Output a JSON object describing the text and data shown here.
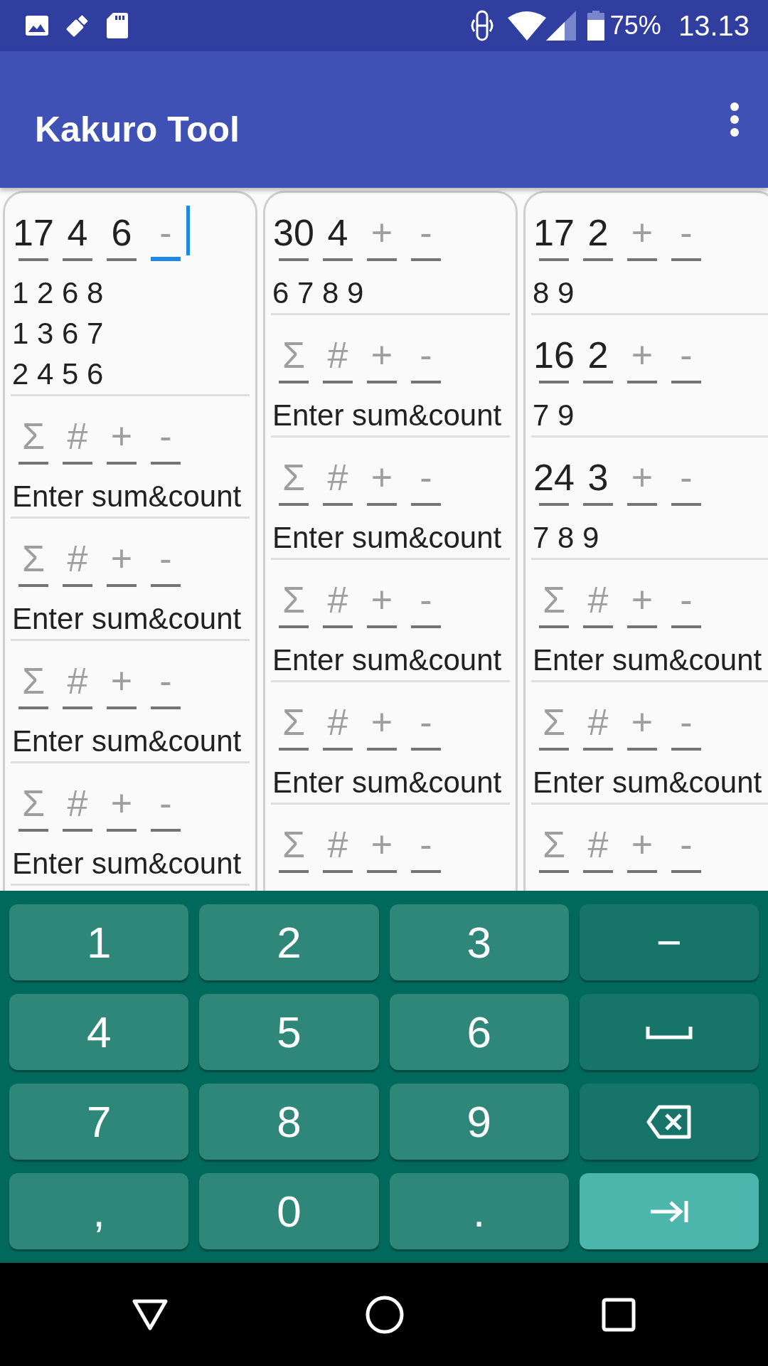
{
  "status_bar": {
    "battery": "75%",
    "time": "13.13"
  },
  "app_bar": {
    "title": "Kakuro Tool"
  },
  "columns": [
    {
      "entries": [
        {
          "fields": [
            {
              "value": "17",
              "focused": false
            },
            {
              "value": "4",
              "focused": false
            },
            {
              "value": "6",
              "focused": false
            },
            {
              "placeholder": "-",
              "focused": true
            }
          ],
          "lines": [
            "1 2 6 8",
            "1 3 6 7",
            "2 4 5 6"
          ]
        },
        {
          "fields": [
            {
              "placeholder": "Σ",
              "focused": false
            },
            {
              "placeholder": "#",
              "focused": false
            },
            {
              "placeholder": "+",
              "focused": false
            },
            {
              "placeholder": "-",
              "focused": false
            }
          ],
          "lines": [
            "Enter sum&count"
          ]
        },
        {
          "fields": [
            {
              "placeholder": "Σ",
              "focused": false
            },
            {
              "placeholder": "#",
              "focused": false
            },
            {
              "placeholder": "+",
              "focused": false
            },
            {
              "placeholder": "-",
              "focused": false
            }
          ],
          "lines": [
            "Enter sum&count"
          ]
        },
        {
          "fields": [
            {
              "placeholder": "Σ",
              "focused": false
            },
            {
              "placeholder": "#",
              "focused": false
            },
            {
              "placeholder": "+",
              "focused": false
            },
            {
              "placeholder": "-",
              "focused": false
            }
          ],
          "lines": [
            "Enter sum&count"
          ]
        },
        {
          "fields": [
            {
              "placeholder": "Σ",
              "focused": false
            },
            {
              "placeholder": "#",
              "focused": false
            },
            {
              "placeholder": "+",
              "focused": false
            },
            {
              "placeholder": "-",
              "focused": false
            }
          ],
          "lines": [
            "Enter sum&count"
          ]
        }
      ]
    },
    {
      "entries": [
        {
          "fields": [
            {
              "value": "30",
              "focused": false
            },
            {
              "value": "4",
              "focused": false
            },
            {
              "placeholder": "+",
              "focused": false
            },
            {
              "placeholder": "-",
              "focused": false
            }
          ],
          "lines": [
            "6 7 8 9"
          ]
        },
        {
          "fields": [
            {
              "placeholder": "Σ",
              "focused": false
            },
            {
              "placeholder": "#",
              "focused": false
            },
            {
              "placeholder": "+",
              "focused": false
            },
            {
              "placeholder": "-",
              "focused": false
            }
          ],
          "lines": [
            "Enter sum&count"
          ]
        },
        {
          "fields": [
            {
              "placeholder": "Σ",
              "focused": false
            },
            {
              "placeholder": "#",
              "focused": false
            },
            {
              "placeholder": "+",
              "focused": false
            },
            {
              "placeholder": "-",
              "focused": false
            }
          ],
          "lines": [
            "Enter sum&count"
          ]
        },
        {
          "fields": [
            {
              "placeholder": "Σ",
              "focused": false
            },
            {
              "placeholder": "#",
              "focused": false
            },
            {
              "placeholder": "+",
              "focused": false
            },
            {
              "placeholder": "-",
              "focused": false
            }
          ],
          "lines": [
            "Enter sum&count"
          ]
        },
        {
          "fields": [
            {
              "placeholder": "Σ",
              "focused": false
            },
            {
              "placeholder": "#",
              "focused": false
            },
            {
              "placeholder": "+",
              "focused": false
            },
            {
              "placeholder": "-",
              "focused": false
            }
          ],
          "lines": [
            "Enter sum&count"
          ]
        },
        {
          "fields": [
            {
              "placeholder": "Σ",
              "focused": false
            },
            {
              "placeholder": "#",
              "focused": false
            },
            {
              "placeholder": "+",
              "focused": false
            },
            {
              "placeholder": "-",
              "focused": false
            }
          ]
        }
      ]
    },
    {
      "entries": [
        {
          "fields": [
            {
              "value": "17",
              "focused": false
            },
            {
              "value": "2",
              "focused": false
            },
            {
              "placeholder": "+",
              "focused": false
            },
            {
              "placeholder": "-",
              "focused": false
            }
          ],
          "lines": [
            "8 9"
          ]
        },
        {
          "fields": [
            {
              "value": "16",
              "focused": false
            },
            {
              "value": "2",
              "focused": false
            },
            {
              "placeholder": "+",
              "focused": false
            },
            {
              "placeholder": "-",
              "focused": false
            }
          ],
          "lines": [
            "7 9"
          ]
        },
        {
          "fields": [
            {
              "value": "24",
              "focused": false
            },
            {
              "value": "3",
              "focused": false
            },
            {
              "placeholder": "+",
              "focused": false
            },
            {
              "placeholder": "-",
              "focused": false
            }
          ],
          "lines": [
            "7 8 9"
          ]
        },
        {
          "fields": [
            {
              "placeholder": "Σ",
              "focused": false
            },
            {
              "placeholder": "#",
              "focused": false
            },
            {
              "placeholder": "+",
              "focused": false
            },
            {
              "placeholder": "-",
              "focused": false
            }
          ],
          "lines": [
            "Enter sum&count"
          ]
        },
        {
          "fields": [
            {
              "placeholder": "Σ",
              "focused": false
            },
            {
              "placeholder": "#",
              "focused": false
            },
            {
              "placeholder": "+",
              "focused": false
            },
            {
              "placeholder": "-",
              "focused": false
            }
          ],
          "lines": [
            "Enter sum&count"
          ]
        },
        {
          "fields": [
            {
              "placeholder": "Σ",
              "focused": false
            },
            {
              "placeholder": "#",
              "focused": false
            },
            {
              "placeholder": "+",
              "focused": false
            },
            {
              "placeholder": "-",
              "focused": false
            }
          ]
        }
      ]
    }
  ],
  "keyboard": {
    "keys": [
      {
        "kind": "char",
        "label": "1"
      },
      {
        "kind": "char",
        "label": "2"
      },
      {
        "kind": "char",
        "label": "3"
      },
      {
        "kind": "func",
        "label": "−"
      },
      {
        "kind": "char",
        "label": "4"
      },
      {
        "kind": "char",
        "label": "5"
      },
      {
        "kind": "char",
        "label": "6"
      },
      {
        "kind": "space"
      },
      {
        "kind": "char",
        "label": "7"
      },
      {
        "kind": "char",
        "label": "8"
      },
      {
        "kind": "char",
        "label": "9"
      },
      {
        "kind": "backspace"
      },
      {
        "kind": "char",
        "label": ","
      },
      {
        "kind": "char",
        "label": "0"
      },
      {
        "kind": "char",
        "label": "."
      },
      {
        "kind": "action"
      }
    ]
  }
}
